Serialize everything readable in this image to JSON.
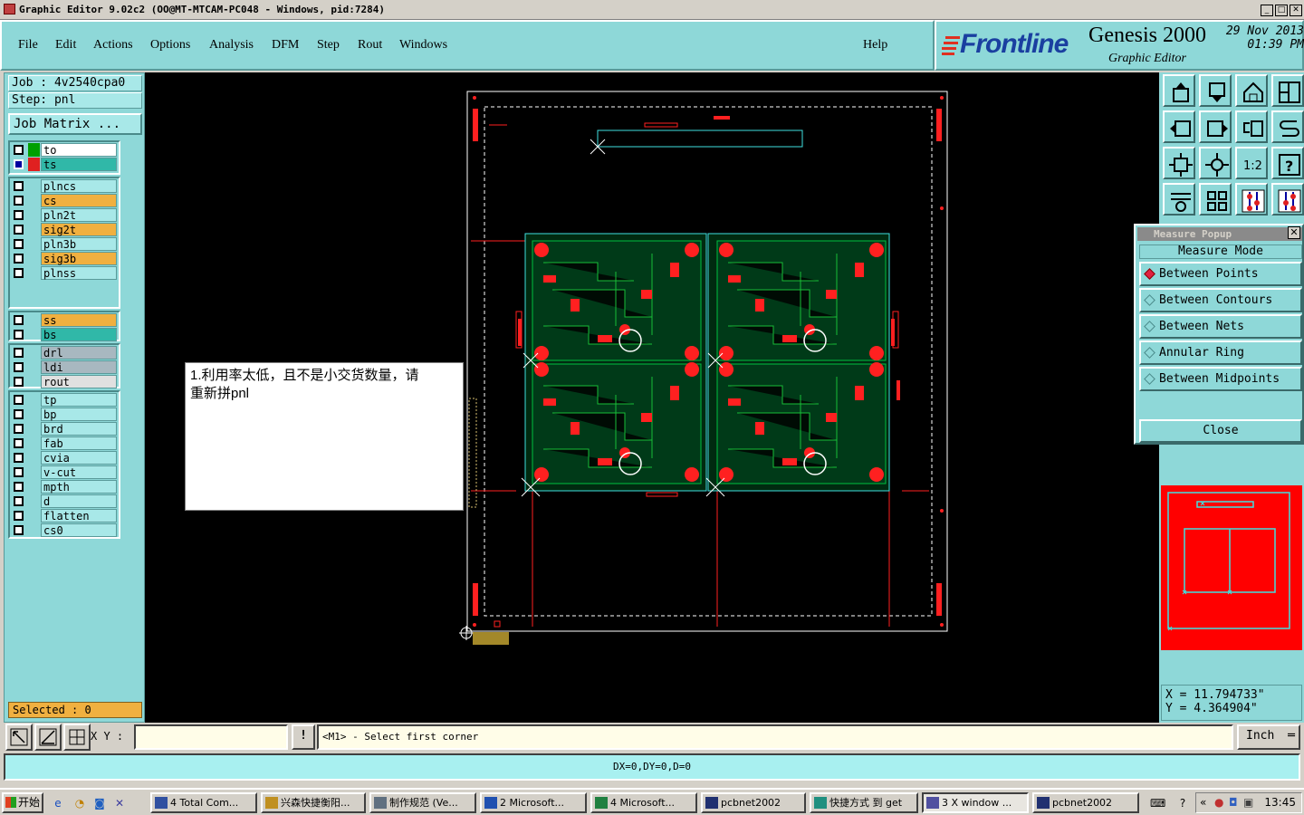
{
  "window": {
    "title": "Graphic Editor 9.02c2 (OO@MT-MTCAM-PC048 - Windows, pid:7284)",
    "controls": [
      "_",
      "□",
      "✕"
    ]
  },
  "menu": {
    "items": [
      "File",
      "Edit",
      "Actions",
      "Options",
      "Analysis",
      "DFM",
      "Step",
      "Rout",
      "Windows"
    ],
    "help": "Help"
  },
  "brand": {
    "logo": "Frontline",
    "product": "Genesis 2000",
    "subtitle": "Graphic Editor",
    "date": "29 Nov 2013",
    "time": "01:39 PM"
  },
  "left": {
    "job": "Job : 4v2540cpa0",
    "step": "Step: pnl",
    "job_matrix": "Job Matrix ...",
    "layers_group1": [
      {
        "name": "to",
        "color": "#00a000",
        "bg": "#ffffff"
      },
      {
        "name": "ts",
        "color": "#e02020",
        "bg": "#30b8a8"
      }
    ],
    "layers_group2": [
      {
        "name": "plncs",
        "bg": "#a8e8e8"
      },
      {
        "name": "cs",
        "bg": "#f0b040"
      },
      {
        "name": "pln2t",
        "bg": "#a8e8e8"
      },
      {
        "name": "sig2t",
        "bg": "#f0b040"
      },
      {
        "name": "pln3b",
        "bg": "#a8e8e8"
      },
      {
        "name": "sig3b",
        "bg": "#f0b040"
      },
      {
        "name": "plnss",
        "bg": "#a8e8e8"
      }
    ],
    "layers_group3": [
      {
        "name": "ss",
        "bg": "#f0b040"
      },
      {
        "name": "bs",
        "bg": "#30b8a8"
      }
    ],
    "layers_group4": [
      {
        "name": "drl",
        "bg": "#a8b8c0"
      },
      {
        "name": "ldi",
        "bg": "#a8b8c0"
      },
      {
        "name": "rout",
        "bg": "#e0e0e0"
      }
    ],
    "layers_group5": [
      {
        "name": "tp",
        "bg": "#a8e8e8"
      },
      {
        "name": "bp",
        "bg": "#a8e8e8"
      },
      {
        "name": "brd",
        "bg": "#a8e8e8"
      },
      {
        "name": "fab",
        "bg": "#a8e8e8"
      },
      {
        "name": "cvia",
        "bg": "#a8e8e8"
      },
      {
        "name": "v-cut",
        "bg": "#a8e8e8"
      },
      {
        "name": "mpth",
        "bg": "#a8e8e8"
      },
      {
        "name": "d",
        "bg": "#a8e8e8"
      },
      {
        "name": "flatten",
        "bg": "#a8e8e8"
      },
      {
        "name": "cs0",
        "bg": "#a8e8e8"
      }
    ],
    "selected": "Selected : 0"
  },
  "canvas": {
    "note_line1": "1.利用率太低，且不是小交货数量，请",
    "note_line2": "重新拼pnl"
  },
  "measure": {
    "title": "Measure Popup",
    "mode_label": "Measure Mode",
    "options": [
      "Between Points",
      "Between Contours",
      "Between Nets",
      "Annular Ring",
      "Between Midpoints"
    ],
    "selected_option": "Between Points",
    "close": "Close"
  },
  "coords": {
    "x": "X = 11.794733\"",
    "y": "Y = 4.364904\""
  },
  "input": {
    "xy_label": "X Y :",
    "xy_value": "",
    "excl": "!",
    "prompt": "<M1> - Select first corner",
    "unit": "Inch"
  },
  "status": {
    "text": "DX=0,DY=0,D=0"
  },
  "taskbar": {
    "start": "开始",
    "tasks": [
      "4 Total Com...",
      "兴森快捷衡阳...",
      "制作规范 (Ve...",
      "2 Microsoft...",
      "4 Microsoft...",
      "pcbnet2002",
      "快捷方式 到 get",
      "3 X window ...",
      "pcbnet2002"
    ],
    "clock": "13:45"
  }
}
